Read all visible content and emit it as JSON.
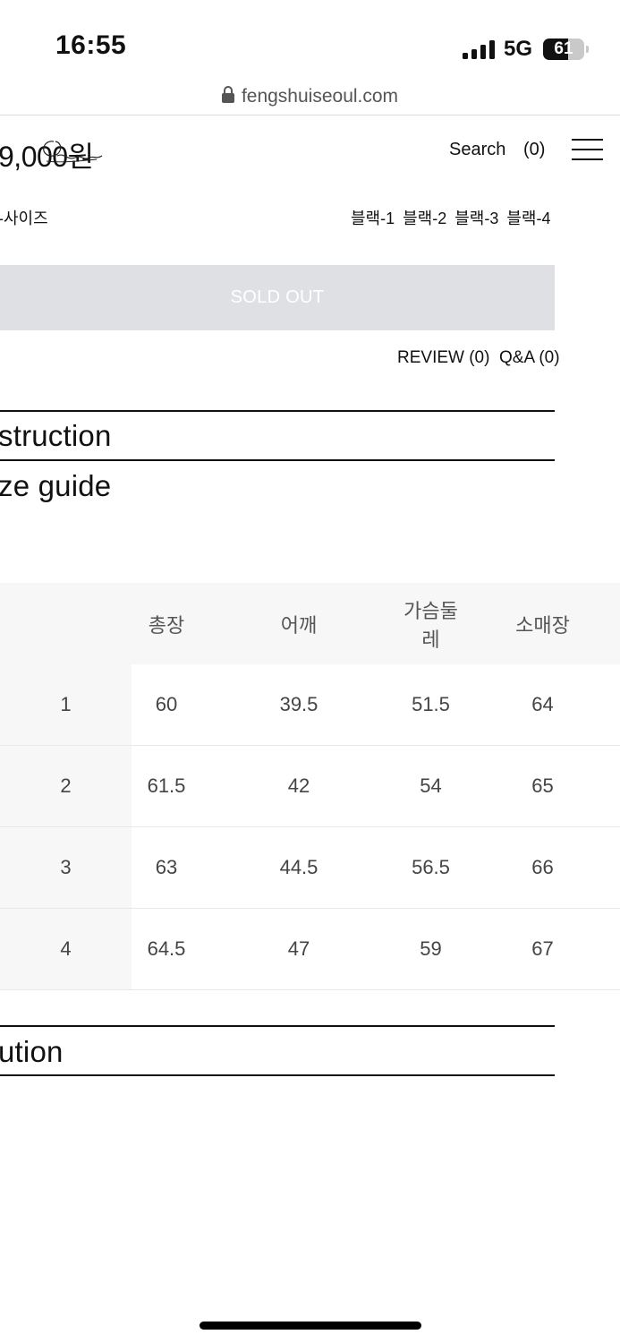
{
  "status_bar": {
    "time": "16:55",
    "network": "5G",
    "battery": "61"
  },
  "browser": {
    "url": "fengshuiseoul.com"
  },
  "header": {
    "price": "9,000원",
    "search_label": "Search",
    "cart_count": "(0)"
  },
  "product": {
    "size_label": "-사이즈",
    "color_options": [
      "블랙-1",
      "블랙-2",
      "블랙-3",
      "블랙-4"
    ],
    "sold_out_label": "SOLD OUT",
    "review_label": "REVIEW (0)",
    "qna_label": "Q&A (0)"
  },
  "sections": {
    "instruction": "struction",
    "size_guide": "ze guide",
    "caution": "ution"
  },
  "size_table": {
    "headers": [
      "",
      "총장",
      "어깨",
      "가슴둘레",
      "소매장"
    ],
    "rows": [
      [
        "1",
        "60",
        "39.5",
        "51.5",
        "64"
      ],
      [
        "2",
        "61.5",
        "42",
        "54",
        "65"
      ],
      [
        "3",
        "63",
        "44.5",
        "56.5",
        "66"
      ],
      [
        "4",
        "64.5",
        "47",
        "59",
        "67"
      ]
    ]
  }
}
